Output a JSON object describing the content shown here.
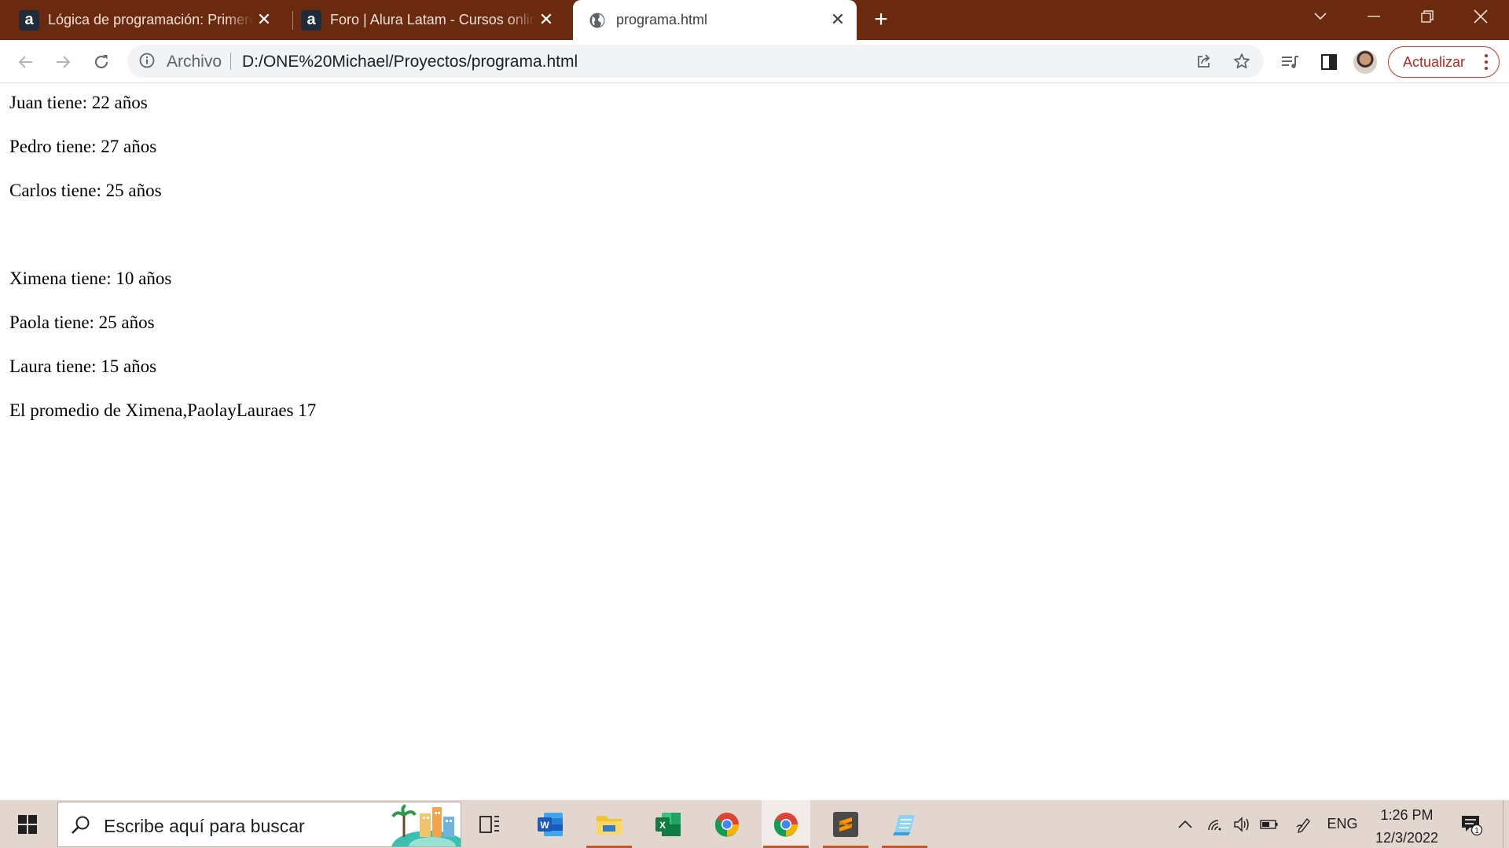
{
  "browser": {
    "tabs": [
      {
        "title": "Lógica de programación: Primeros",
        "favicon": "a"
      },
      {
        "title": "Foro | Alura Latam - Cursos online",
        "favicon": "a"
      },
      {
        "title": "programa.html",
        "favicon": "globe"
      }
    ],
    "active_tab_index": 2,
    "address": {
      "scheme_label": "Archivo",
      "url": "D:/ONE%20Michael/Proyectos/programa.html"
    },
    "update_button_label": "Actualizar"
  },
  "page": {
    "lines": [
      "Juan tiene: 22 años",
      "Pedro tiene: 27 años",
      "Carlos tiene: 25 años",
      "Ximena tiene: 10 años",
      "Paola tiene: 25 años",
      "Laura tiene: 15 años",
      "El promedio de Ximena,PaolayLauraes 17"
    ]
  },
  "taskbar": {
    "search_placeholder": "Escribe aquí para buscar",
    "apps": [
      "task-view",
      "word",
      "file-explorer",
      "excel",
      "chrome",
      "chrome",
      "sublime-text",
      "notepad"
    ],
    "tray": {
      "language": "ENG",
      "time": "1:26 PM",
      "date": "12/3/2022",
      "notification_count": "1"
    }
  },
  "colors": {
    "tab_strip": "#6b2a0f",
    "taskbar": "#e3d6cf",
    "update_accent": "#c5221f"
  }
}
